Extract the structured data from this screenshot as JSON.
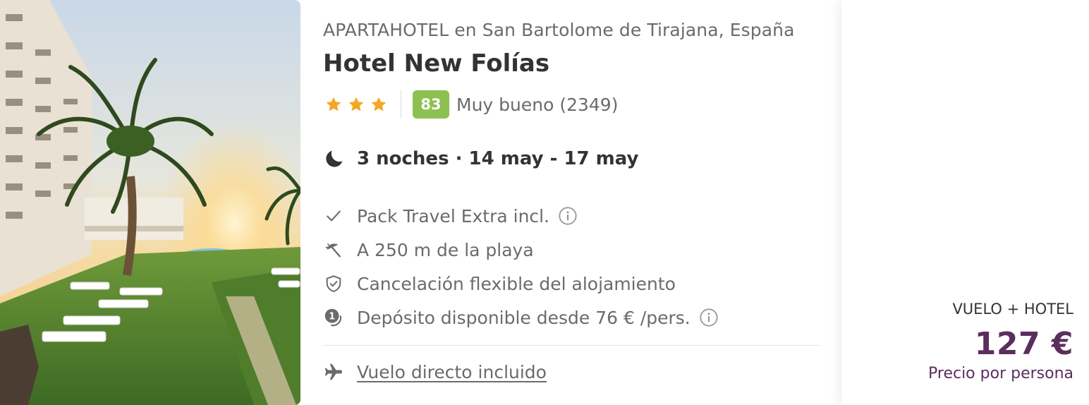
{
  "hotel": {
    "location": "APARTAHOTEL en San Bartolome de Tirajana, España",
    "name": "Hotel New Folías",
    "star_count": 3,
    "score": "83",
    "rating_text": "Muy bueno (2349)",
    "stay": "3 noches · 14 may - 17 may",
    "image_icon": "hotel-photo"
  },
  "features": [
    {
      "icon": "check-icon",
      "text": "Pack Travel Extra incl.",
      "has_info": true
    },
    {
      "icon": "beach-umbrella-icon",
      "text": "A 250 m de la playa",
      "has_info": false
    },
    {
      "icon": "shield-check-icon",
      "text": "Cancelación flexible del alojamiento",
      "has_info": false
    },
    {
      "icon": "installment-icon",
      "text": "Depósito disponible desde 76 € /pers.",
      "has_info": true
    }
  ],
  "flight": {
    "icon": "plane-icon",
    "text": "Vuelo directo incluido"
  },
  "price": {
    "label": "VUELO + HOTEL",
    "value": "127 €",
    "sub": "Precio por persona"
  },
  "colors": {
    "star": "#f5a623",
    "score_badge": "#8cc152",
    "price": "#5b2e5e",
    "muted_text": "#6b6b6b",
    "dark_text": "#333333"
  }
}
